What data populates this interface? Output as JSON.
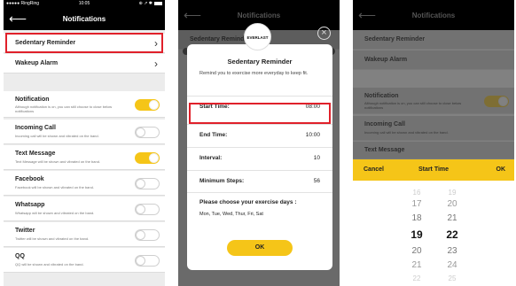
{
  "status": {
    "carrier": "●●●●● RingRing",
    "wifi_icon": "wifi-icon",
    "time": "10:05",
    "right_icons": "⊕ ↗ ✱"
  },
  "header": {
    "title": "Notifications",
    "back_icon": "arrow-left-icon"
  },
  "menu": [
    {
      "label": "Sedentary Reminder"
    },
    {
      "label": "Wakeup Alarm"
    }
  ],
  "notifications": [
    {
      "title": "Notification",
      "desc": "Although notification is on, you can still choose to close below notifications",
      "on": true
    },
    {
      "title": "Incoming Call",
      "desc": "Incoming call will be shown and vibrated on the band.",
      "on": false
    },
    {
      "title": "Text Message",
      "desc": "Text Message will be shown and vibrated on the band.",
      "on": true
    },
    {
      "title": "Facebook",
      "desc": "Facebook will be shown and vibrated on the band.",
      "on": false
    },
    {
      "title": "Whatsapp",
      "desc": "Whatsapp will be shown and vibrated on the band.",
      "on": false
    },
    {
      "title": "Twitter",
      "desc": "Twitter will be shown and vibrated on the band.",
      "on": false
    },
    {
      "title": "QQ",
      "desc": "QQ will be shown and vibrated on the band.",
      "on": false
    }
  ],
  "dialog": {
    "logo_text": "EVERLAST",
    "title": "Sedentary Reminder",
    "message": "Remind you to exercise more everyday to keep fit.",
    "rows": [
      {
        "label": "Start Time:",
        "value": "08:00"
      },
      {
        "label": "End Time:",
        "value": "10:00"
      },
      {
        "label": "Interval:",
        "value": "10"
      },
      {
        "label": "Minimum Steps:",
        "value": "56"
      }
    ],
    "days_question": "Please choose your exercise days :",
    "days": "Mon,  Tue,  Wed,  Thur,  Fri,  Sat",
    "ok_label": "OK",
    "close_icon": "close-icon"
  },
  "picker": {
    "cancel_label": "Cancel",
    "title": "Start Time",
    "ok_label": "OK",
    "hours": [
      "16",
      "17",
      "18",
      "19",
      "20",
      "21",
      "22"
    ],
    "minutes": [
      "19",
      "20",
      "21",
      "22",
      "23",
      "24",
      "25"
    ],
    "selected_hour": "19",
    "selected_minute": "22"
  },
  "colors": {
    "accent": "#f5c518",
    "highlight": "#e0202a",
    "navbar": "#000000"
  }
}
